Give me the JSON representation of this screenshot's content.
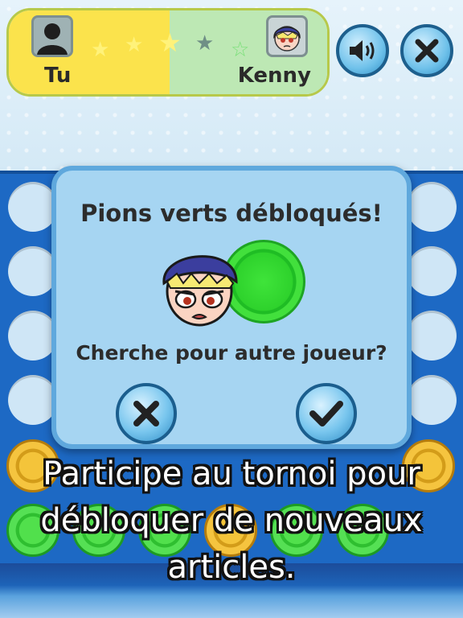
{
  "scoreboard": {
    "player_name": "Tu",
    "opponent_name": "Kenny",
    "stars": [
      {
        "icon": "star-filled-icon",
        "color": "#fff27a"
      },
      {
        "icon": "star-filled-icon",
        "color": "#fff27a"
      },
      {
        "icon": "star-filled-icon",
        "color": "#fff27a"
      },
      {
        "icon": "star-filled-icon",
        "color": "#6f8f86"
      },
      {
        "icon": "star-outline-icon",
        "color": "#7be07a"
      }
    ]
  },
  "controls": {
    "sound_icon": "speaker-icon",
    "close_icon": "close-icon"
  },
  "dialog": {
    "title": "Pions verts débloqués!",
    "question": "Cherche pour autre joueur?",
    "cancel_icon": "close-icon",
    "confirm_icon": "check-icon",
    "unlocked_chip_color": "#2ed22c"
  },
  "caption": {
    "line1": "Participe au tornoi pour",
    "line2": "débloquer de nouveaux",
    "line3": "articles."
  },
  "colors": {
    "board": "#1d69c4",
    "green_chip": "#2fbf30",
    "yellow_chip": "#d39c19"
  }
}
